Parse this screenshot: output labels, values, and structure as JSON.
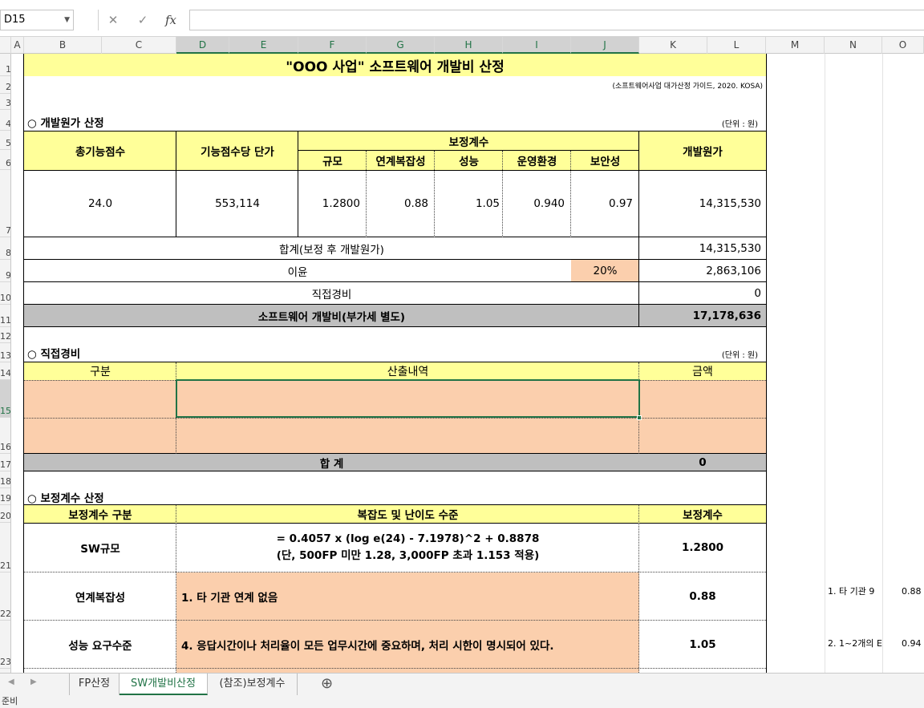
{
  "formula_bar": {
    "name_box": "D15",
    "cancel_icon": "✕",
    "enter_icon": "✓",
    "fx_label": "fx",
    "formula": ""
  },
  "columns": [
    "A",
    "B",
    "C",
    "D",
    "E",
    "F",
    "G",
    "H",
    "I",
    "J",
    "K",
    "L",
    "M",
    "N",
    "O"
  ],
  "rows": [
    "1",
    "2",
    "3",
    "4",
    "5",
    "6",
    "7",
    "8",
    "9",
    "10",
    "11",
    "12",
    "13",
    "14",
    "15",
    "16",
    "17",
    "18",
    "19",
    "20",
    "21",
    "22",
    "23"
  ],
  "title": "\"OOO 사업\" 소프트웨어 개발비 산정",
  "source_note": "(소프트웨어사업 대가산정 가이드, 2020. KOSA)",
  "sec1": {
    "title": "○ 개발원가 산정",
    "unit": "(단위 : 원)",
    "h_total_fp": "총기능점수",
    "h_unit_price": "기능점수당 단가",
    "h_adjust": "보정계수",
    "h_scale": "규모",
    "h_complex": "연계복잡성",
    "h_perf": "성능",
    "h_env": "운영환경",
    "h_security": "보안성",
    "h_dev_cost": "개발원가",
    "v_total_fp": "24.0",
    "v_unit_price": "553,114",
    "v_scale": "1.2800",
    "v_complex": "0.88",
    "v_perf": "1.05",
    "v_env": "0.940",
    "v_security": "0.97",
    "v_dev_cost": "14,315,530",
    "sum_label": "합계(보정 후 개발원가)",
    "sum_value": "14,315,530",
    "profit_label": "이윤",
    "profit_rate": "20%",
    "profit_value": "2,863,106",
    "direct_label": "직접경비",
    "direct_value": "0",
    "total_label": "소프트웨어 개발비(부가세 별도)",
    "total_value": "17,178,636"
  },
  "sec2": {
    "title": "○ 직접경비",
    "unit": "(단위 : 원)",
    "h_category": "구분",
    "h_detail": "산출내역",
    "h_amount": "금액",
    "sum_label": "합 계",
    "sum_value": "0"
  },
  "sec3": {
    "title": "○ 보정계수 산정",
    "h_category": "보정계수 구분",
    "h_level": "복잡도 및 난이도 수준",
    "h_coef": "보정계수",
    "r1_label": "SW규모",
    "r1_line1": "= 0.4057 x (log e(24) - 7.1978)^2 + 0.8878",
    "r1_line2": "(단, 500FP 미만 1.28, 3,000FP 초과 1.153 적용)",
    "r1_value": "1.2800",
    "r2_label": "연계복잡성",
    "r2_text": "1. 타 기관 연계 없음",
    "r2_value": "0.88",
    "r3_label": "성능 요구수준",
    "r3_text": "4. 응답시간이나 처리율이 모든 업무시간에 중요하며, 처리 시한이 명시되어 있다.",
    "r3_value": "1.05",
    "side1_text": "1. 타 기관 9",
    "side1_val": "0.88",
    "side2_text": "2. 1~2개의 E",
    "side2_val": "0.94"
  },
  "tabs": {
    "t1": "FP산정",
    "t2": "SW개발비산정",
    "t3": "(참조)보정계수",
    "add": "⊕"
  },
  "status": "준비"
}
